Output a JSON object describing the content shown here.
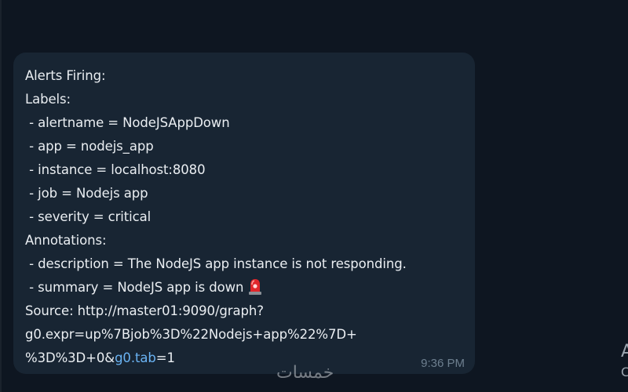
{
  "message": {
    "lines": {
      "l0": "Alerts Firing:",
      "l1": "Labels:",
      "l2": " - alertname = NodeJSAppDown",
      "l3": " - app = nodejs_app",
      "l4": " - instance = localhost:8080",
      "l5": " - job = Nodejs app",
      "l6": " - severity = critical",
      "l7": "Annotations:",
      "l8": " - description = The NodeJS app instance is not responding.",
      "l9": " - summary = NodeJS app is down",
      "l10": "Source: http://master01:9090/graph?",
      "l11": "g0.expr=up%7Bjob%3D%22Nodejs+app%22%7D+",
      "l12_pre": "%3D%3D+0&",
      "l12_link": "g0.tab",
      "l12_post": "=1"
    },
    "emoji_icon": "police-siren-icon",
    "time": "9:36 PM"
  },
  "edge": {
    "glyph1": "A",
    "glyph2": "C"
  },
  "watermark": "خمسات",
  "colors": {
    "background": "#0e1621",
    "bubble": "#182533",
    "text": "#eaeef2",
    "link": "#6ab3f3",
    "time": "#6d7f8f"
  }
}
